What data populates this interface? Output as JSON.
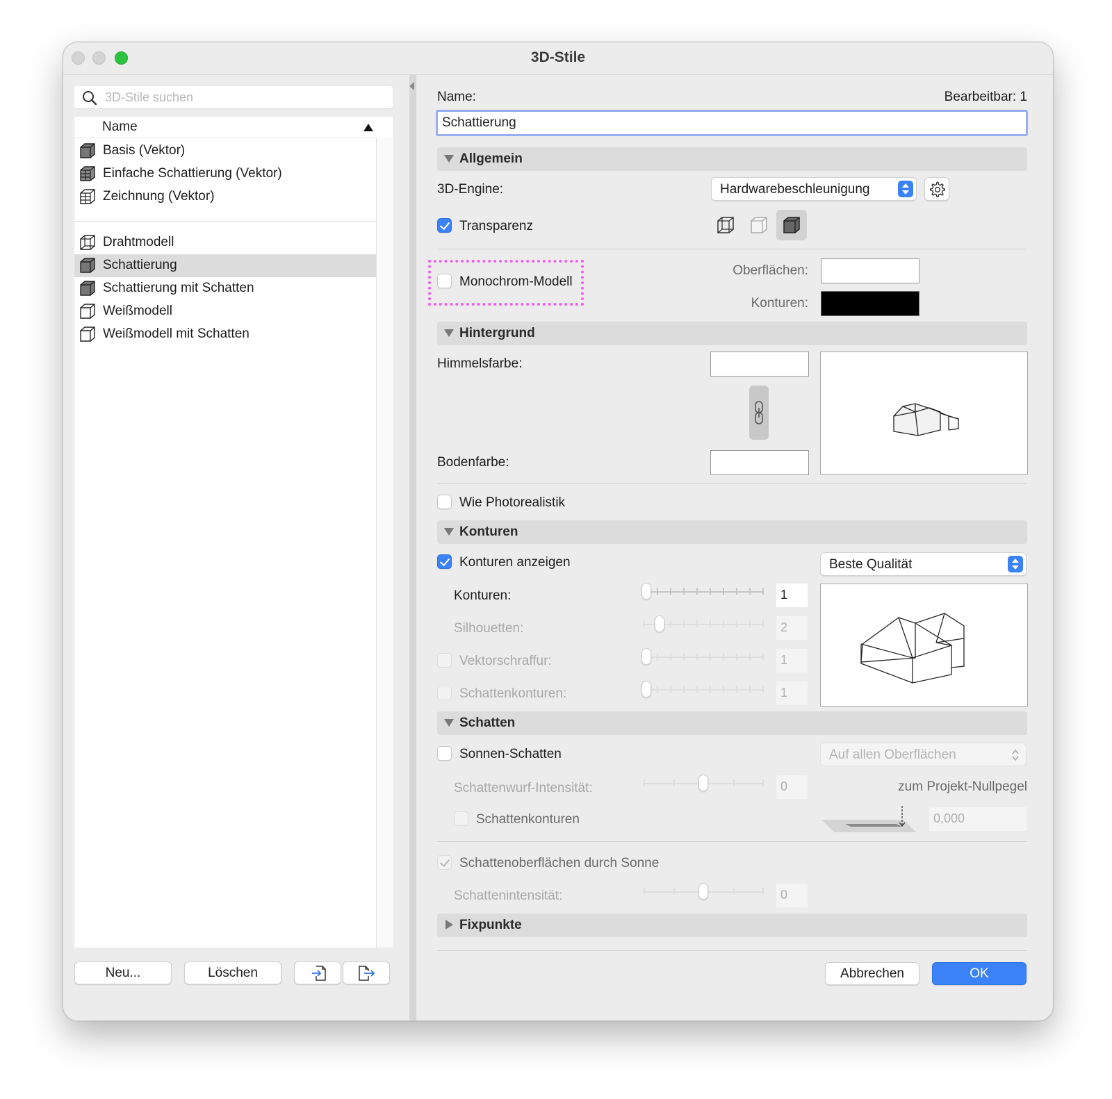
{
  "window": {
    "title": "3D-Stile"
  },
  "search": {
    "placeholder": "3D-Stile suchen"
  },
  "list": {
    "header": "Name",
    "group1": [
      {
        "label": "Basis (Vektor)"
      },
      {
        "label": "Einfache Schattierung (Vektor)"
      },
      {
        "label": "Zeichnung (Vektor)"
      }
    ],
    "group2": [
      {
        "label": "Drahtmodell"
      },
      {
        "label": "Schattierung",
        "selected": true
      },
      {
        "label": "Schattierung mit Schatten"
      },
      {
        "label": "Weißmodell"
      },
      {
        "label": "Weißmodell mit Schatten"
      }
    ]
  },
  "left_buttons": {
    "new": "Neu...",
    "delete": "Löschen",
    "import_icon": "import-icon",
    "export_icon": "export-icon"
  },
  "form": {
    "name_label": "Name:",
    "editable": "Bearbeitbar: 1",
    "name_value": "Schattierung",
    "general": {
      "title": "Allgemein",
      "engine_label": "3D-Engine:",
      "engine_value": "Hardwarebeschleunigung",
      "transparency": "Transparenz",
      "monochrome": "Monochrom-Modell",
      "surfaces_label": "Oberflächen:",
      "contours_label": "Konturen:",
      "surface_color": "#ffffff",
      "contour_color": "#000000"
    },
    "background": {
      "title": "Hintergrund",
      "sky_label": "Himmelsfarbe:",
      "ground_label": "Bodenfarbe:",
      "photorealistic": "Wie Photorealistik"
    },
    "contours": {
      "title": "Konturen",
      "show": "Konturen anzeigen",
      "quality": "Beste Qualität",
      "contours_label": "Konturen:",
      "contours_value": "1",
      "silhouettes_label": "Silhouetten:",
      "silhouettes_value": "2",
      "vector_hatch_label": "Vektorschraffur:",
      "vector_hatch_value": "1",
      "shadow_contours_label": "Schattenkonturen:",
      "shadow_contours_value": "1"
    },
    "shadows": {
      "title": "Schatten",
      "sun_shadows": "Sonnen-Schatten",
      "surfaces_mode": "Auf allen Oberflächen",
      "cast_intensity_label": "Schattenwurf-Intensität:",
      "cast_intensity_value": "0",
      "project_zero": "zum Projekt-Nullpegel",
      "shadow_contours": "Schattenkonturen",
      "elevation_value": "0,000",
      "shaded_surfaces": "Schattenoberflächen durch Sonne",
      "shade_intensity_label": "Schattenintensität:",
      "shade_intensity_value": "0"
    },
    "fixpoints": {
      "title": "Fixpunkte"
    }
  },
  "buttons": {
    "cancel": "Abbrechen",
    "ok": "OK"
  },
  "colors": {
    "accent": "#3a82f6",
    "highlight": "#f25cf0"
  }
}
